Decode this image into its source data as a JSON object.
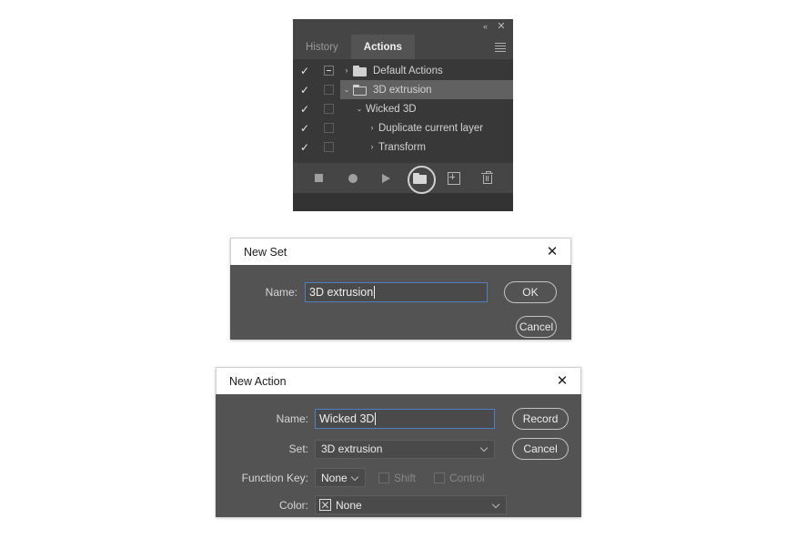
{
  "actions_panel": {
    "titlebar": {
      "collapse_icon": "collapse-left-icon",
      "collapse_glyph": "«",
      "close_icon": "close-icon",
      "close_glyph": "✕"
    },
    "tabs": [
      {
        "label": "History",
        "active": false
      },
      {
        "label": "Actions",
        "active": true
      }
    ],
    "menu_icon": "panel-menu-icon",
    "rows": [
      {
        "label": "Default Actions",
        "checked": true,
        "check_glyph": "✓",
        "toggle_box": "dash",
        "twisty": "›",
        "expanded": false,
        "icon": "folder-icon",
        "indent": 0,
        "selected": false
      },
      {
        "label": "3D extrusion",
        "checked": true,
        "check_glyph": "✓",
        "toggle_box": "empty",
        "twisty": "⌄",
        "expanded": true,
        "icon": "folder-open-icon",
        "indent": 1,
        "selected": true
      },
      {
        "label": "Wicked 3D",
        "checked": true,
        "check_glyph": "✓",
        "toggle_box": "empty",
        "twisty": "⌄",
        "expanded": true,
        "icon": "none",
        "indent": 2,
        "selected": false
      },
      {
        "label": "Duplicate current layer",
        "checked": true,
        "check_glyph": "✓",
        "toggle_box": "empty",
        "twisty": "›",
        "expanded": false,
        "icon": "none",
        "indent": 3,
        "selected": false
      },
      {
        "label": "Transform",
        "checked": true,
        "check_glyph": "✓",
        "toggle_box": "empty",
        "twisty": "›",
        "expanded": false,
        "icon": "none",
        "indent": 3,
        "selected": false
      }
    ],
    "toolbar": [
      {
        "name": "stop-button",
        "icon": "stop-icon"
      },
      {
        "name": "record-button",
        "icon": "record-icon"
      },
      {
        "name": "play-button",
        "icon": "play-icon"
      },
      {
        "name": "new-set-button",
        "icon": "new-set-folder-icon",
        "highlighted": true
      },
      {
        "name": "new-action-button",
        "icon": "new-action-plus-icon"
      },
      {
        "name": "delete-button",
        "icon": "trash-icon"
      }
    ]
  },
  "new_set_dialog": {
    "title": "New Set",
    "close_glyph": "✕",
    "name_label": "Name:",
    "name_value": "3D extrusion",
    "ok_label": "OK",
    "cancel_label": "Cancel"
  },
  "new_action_dialog": {
    "title": "New Action",
    "close_glyph": "✕",
    "name_label": "Name:",
    "name_value": "Wicked 3D",
    "set_label": "Set:",
    "set_value": "3D extrusion",
    "function_key_label": "Function Key:",
    "function_key_value": "None",
    "shift_label": "Shift",
    "shift_checked": false,
    "control_label": "Control",
    "control_checked": false,
    "color_label": "Color:",
    "color_value": "None",
    "color_swatch_icon": "no-color-x-icon",
    "record_label": "Record",
    "cancel_label": "Cancel"
  },
  "colors": {
    "panel_bg": "#333333",
    "panel_header": "#454545",
    "list_bg": "#383838",
    "row_selected": "#616161",
    "dialog_bg": "#535353",
    "dialog_titlebar": "#ffffff",
    "input_bg": "#4a4a4a",
    "focus_border": "#4f7fbf",
    "text_light": "#ededed",
    "text_muted": "#888888"
  }
}
